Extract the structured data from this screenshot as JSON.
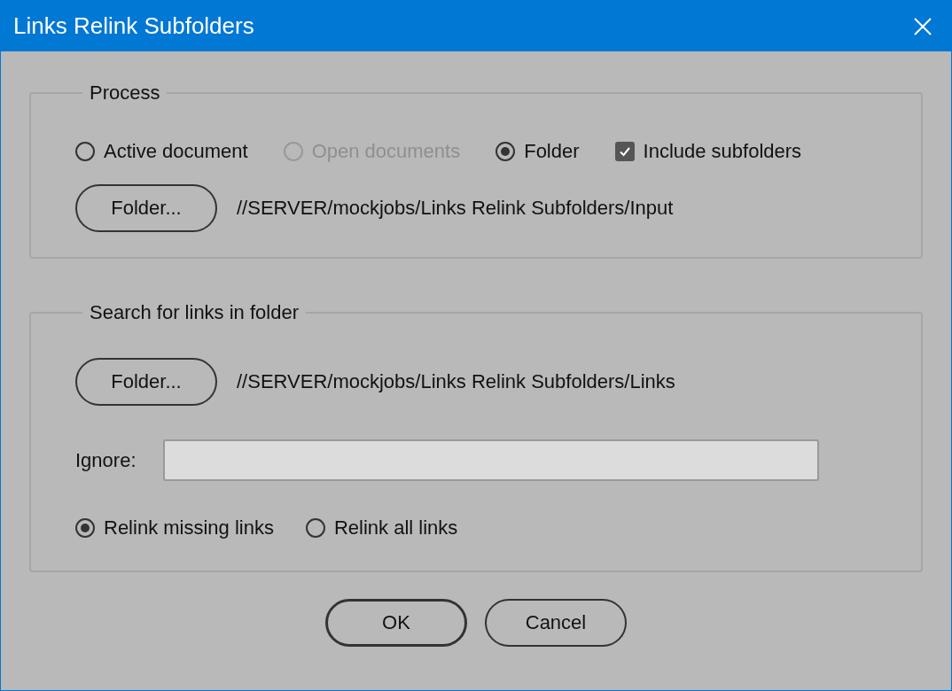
{
  "window": {
    "title": "Links Relink Subfolders"
  },
  "process": {
    "legend": "Process",
    "sources": [
      {
        "label": "Active document",
        "selected": false,
        "disabled": false
      },
      {
        "label": "Open documents",
        "selected": false,
        "disabled": true
      },
      {
        "label": "Folder",
        "selected": true,
        "disabled": false
      }
    ],
    "include_subfolders": {
      "label": "Include subfolders",
      "checked": true
    },
    "folder_button": "Folder...",
    "folder_path": "//SERVER/mockjobs/Links Relink Subfolders/Input"
  },
  "search": {
    "legend": "Search for links in folder",
    "folder_button": "Folder...",
    "folder_path": "//SERVER/mockjobs/Links Relink Subfolders/Links",
    "ignore": {
      "label": "Ignore:"
    },
    "relink_options": [
      {
        "label": "Relink missing links",
        "selected": true
      },
      {
        "label": "Relink all links",
        "selected": false
      }
    ]
  },
  "buttons": [
    {
      "label": "OK",
      "default": true
    },
    {
      "label": "Cancel",
      "default": false
    }
  ]
}
